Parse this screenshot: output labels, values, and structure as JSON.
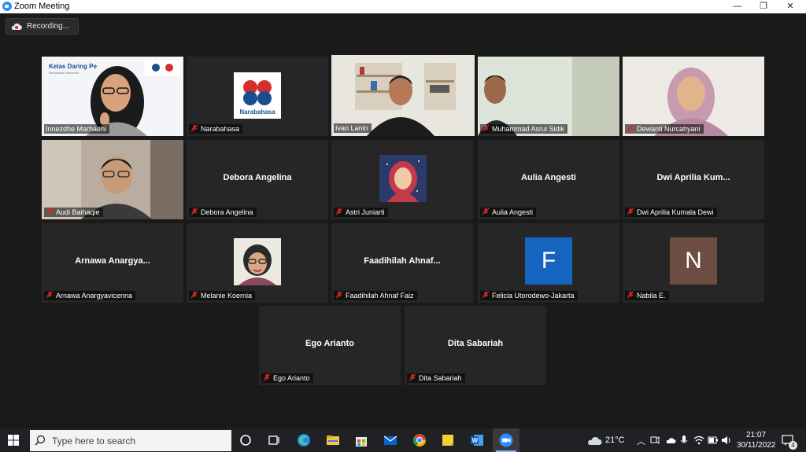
{
  "window": {
    "title": "Zoom Meeting",
    "min": "—",
    "restore": "❐",
    "close": "✕"
  },
  "recording": {
    "label": "Recording..."
  },
  "tiles": [
    {
      "name": "Innezdhe Marhaeni",
      "kind": "video"
    },
    {
      "name": "Narabahasa",
      "kind": "logo",
      "logo_text": "Narabahasa"
    },
    {
      "name": "Ivan Lanin",
      "kind": "video",
      "active": true
    },
    {
      "name": "Muhammad Asrul Sidik",
      "kind": "video"
    },
    {
      "name": "Dewanti Nurcahyani",
      "kind": "video"
    },
    {
      "name": "Audi Baihaqie",
      "kind": "video"
    },
    {
      "name": "Debora Angelina",
      "kind": "name",
      "center": "Debora Angelina"
    },
    {
      "name": "Astri Juniarti",
      "kind": "avatar"
    },
    {
      "name": "Aulia Angesti",
      "kind": "name",
      "center": "Aulia Angesti"
    },
    {
      "name": "Dwi Aprilia Kumala Dewi",
      "kind": "name",
      "center": "Dwi Aprilia Kum..."
    },
    {
      "name": "Arnawa Anargyavicenna",
      "kind": "name",
      "center": "Arnawa Anargya..."
    },
    {
      "name": "Melanie Koernia",
      "kind": "avatar"
    },
    {
      "name": "Faadihilah Ahnaf Faiz",
      "kind": "name",
      "center": "Faadihilah Ahnaf..."
    },
    {
      "name": "Felicia Utorodewo-Jakarta",
      "kind": "letter",
      "letter": "F",
      "color": "#1565c0"
    },
    {
      "name": "Nabila E.",
      "kind": "letter",
      "letter": "N",
      "color": "#6d4c41"
    },
    {
      "name": "Ego Arianto",
      "kind": "name",
      "center": "Ego Arianto"
    },
    {
      "name": "Dita Sabariah",
      "kind": "name",
      "center": "Dita Sabariah"
    }
  ],
  "slide": {
    "title": "Kelas Daring Pe",
    "subtitle": "Berbahasa Indonesia"
  },
  "taskbar": {
    "search_placeholder": "Type here to search",
    "weather": "21°C",
    "time": "21:07",
    "date": "30/11/2022",
    "notifications": "4"
  },
  "colors": {
    "active_border": "#c7e96d",
    "zoom_blue": "#2d8cff",
    "muted_red": "#e02828"
  }
}
